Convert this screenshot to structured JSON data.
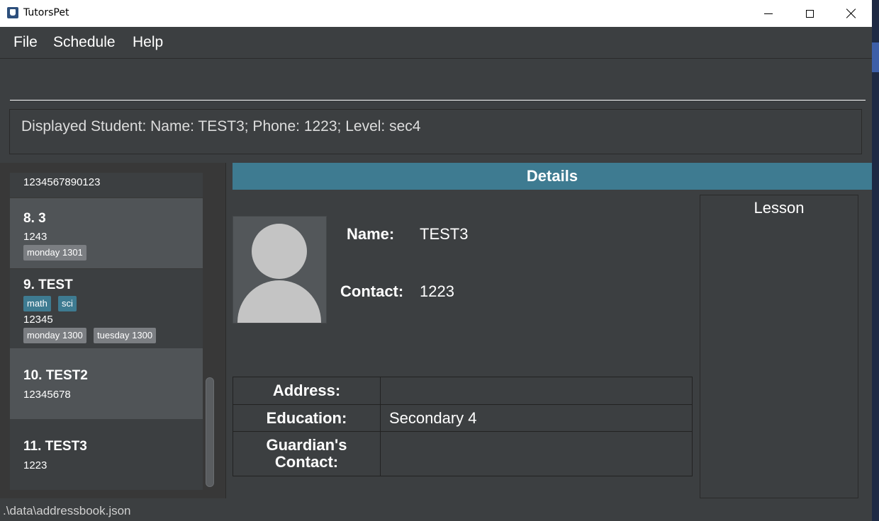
{
  "window": {
    "title": "TutorsPet",
    "icon": "app-icon"
  },
  "menu": {
    "file": "File",
    "schedule": "Schedule",
    "help": "Help"
  },
  "command": {
    "value": "",
    "placeholder": ""
  },
  "result": {
    "text": "Displayed Student: Name: TEST3; Phone: 1223; Level: sec4"
  },
  "students": {
    "partial": {
      "phone": "1234567890123"
    },
    "s8": {
      "name": "8.  3",
      "phone": "1243",
      "lessons": [
        "monday 1301"
      ]
    },
    "s9": {
      "name": "9.  TEST",
      "subjects": [
        "math",
        "sci"
      ],
      "phone": "12345",
      "lessons": [
        "monday 1300",
        "tuesday 1300"
      ]
    },
    "s10": {
      "name": "10.  TEST2",
      "phone": "12345678"
    },
    "s11": {
      "name": "11.  TEST3",
      "phone": "1223"
    }
  },
  "details": {
    "header": "Details",
    "name_label": "Name:",
    "name_value": "TEST3",
    "contact_label": "Contact:",
    "contact_value": "1223",
    "address_label": "Address:",
    "address_value": "",
    "education_label": "Education:",
    "education_value": "Secondary 4",
    "guardian_label_line1": "Guardian's",
    "guardian_label_line2": "Contact:",
    "guardian_value": "",
    "lesson_title": "Lesson"
  },
  "status": {
    "path": ".\\data\\addressbook.json"
  },
  "colors": {
    "accent": "#3e7b91",
    "background": "#3c3f41",
    "tag_grey": "#7b7e82"
  }
}
